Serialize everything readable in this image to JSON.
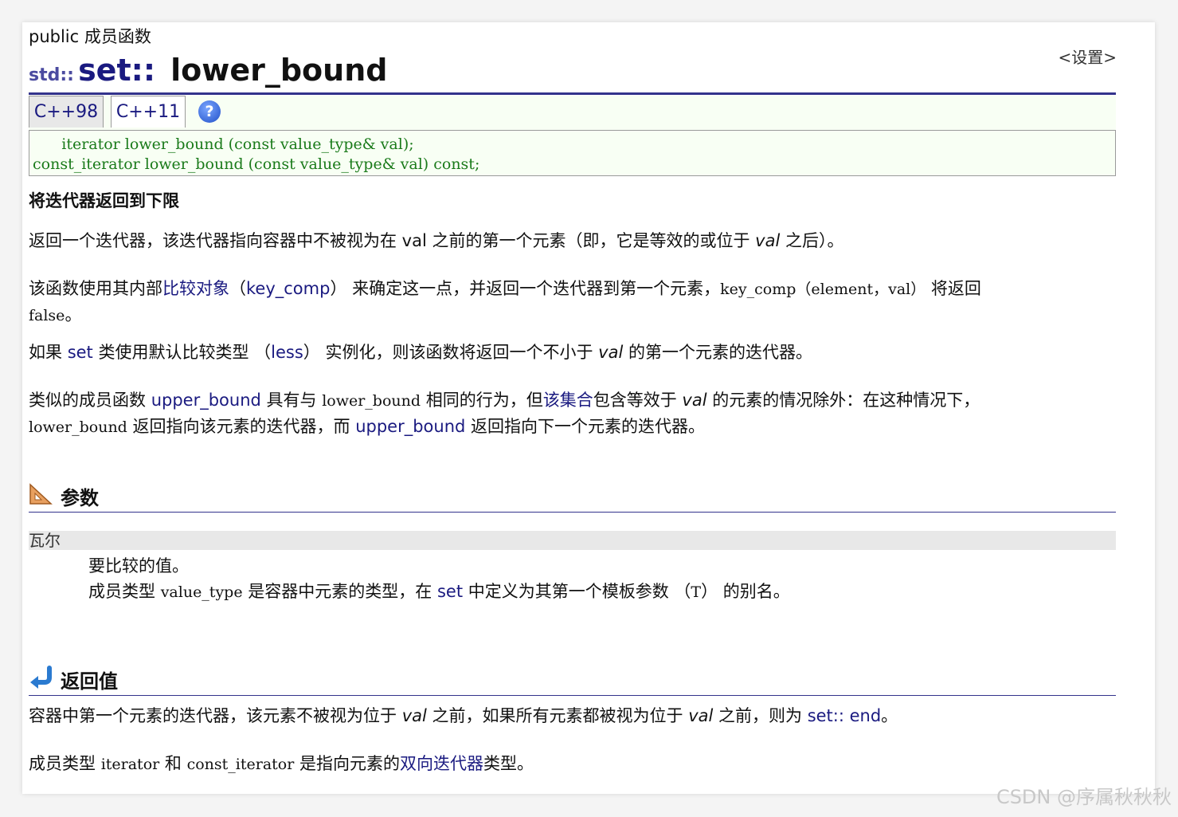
{
  "header": {
    "kind": "public 成员函数",
    "settings": "<设置>",
    "ns": "std::",
    "class_name": "set::",
    "func_name": "lower_bound"
  },
  "tabs": {
    "cpp98": "C++98",
    "cpp11": "C++11",
    "help": "?"
  },
  "code": {
    "line1": "      iterator lower_bound (const value_type& val);",
    "line2": "const_iterator lower_bound (const value_type& val) const;"
  },
  "brief": "将迭代器返回到下限",
  "desc1": {
    "a": "返回一个迭代器，该迭代器指向容器中不被视为在 val 之前的第一个元素（即，它是等效的或位于 ",
    "val": "val",
    "b": " 之后）。"
  },
  "desc2": {
    "a": "该函数使用其内部",
    "link1": "比较对象",
    "b": "（",
    "link2": "key_comp",
    "c": "） 来确定这一点，并返回一个迭代器到第一个元素，",
    "code": "key_comp（element，val）",
    "d": " 将返回",
    "code2": "false",
    "e": "。"
  },
  "desc3": {
    "a": "如果 ",
    "link1": "set",
    "b": " 类使用默认比较类型 （",
    "link2": "less",
    "c": "） 实例化，则该函数将返回一个不小于 ",
    "val": "val",
    "d": " 的第一个元素的迭代器。"
  },
  "desc4": {
    "a": "类似的成员函数 ",
    "link1": "upper_bound",
    "b": " 具有与 ",
    "code1": "lower_bound",
    "c": " 相同的行为，但",
    "link2": "该集合",
    "d": "包含等效于 ",
    "val": "val",
    "e": " 的元素的情况除外：在这种情况下，",
    "code2": "lower_bound",
    "f": " 返回指向该元素的迭代器，而 ",
    "link3": "upper_bound",
    "g": " 返回指向下一个元素的迭代器。"
  },
  "params": {
    "heading": "参数",
    "name": "瓦尔",
    "line1": "要比较的值。",
    "line2a": "成员类型 ",
    "line2code": "value_type",
    "line2b": " 是容器中元素的类型，在 ",
    "line2link": "set",
    "line2c": " 中定义为其第一个模板参数 （",
    "line2code2": "T",
    "line2d": "） 的别名。"
  },
  "retval": {
    "heading": "返回值",
    "p1a": "容器中第一个元素的迭代器，该元素不被视为位于 ",
    "p1val1": "val",
    "p1b": " 之前，如果所有元素都被视为位于 ",
    "p1val2": "val",
    "p1c": " 之前，则为 ",
    "p1link": "set:: end",
    "p1d": "。",
    "p2a": "成员类型 ",
    "p2code1": "iterator",
    "p2b": " 和 ",
    "p2code2": "const_iterator",
    "p2c": " 是指向元素的",
    "p2link": "双向迭代器",
    "p2d": "类型。"
  },
  "watermark": "CSDN @序属秋秋秋",
  "colors": {
    "link": "#1a1a80",
    "code_green": "#1a7a1a",
    "rule": "#33338c"
  }
}
